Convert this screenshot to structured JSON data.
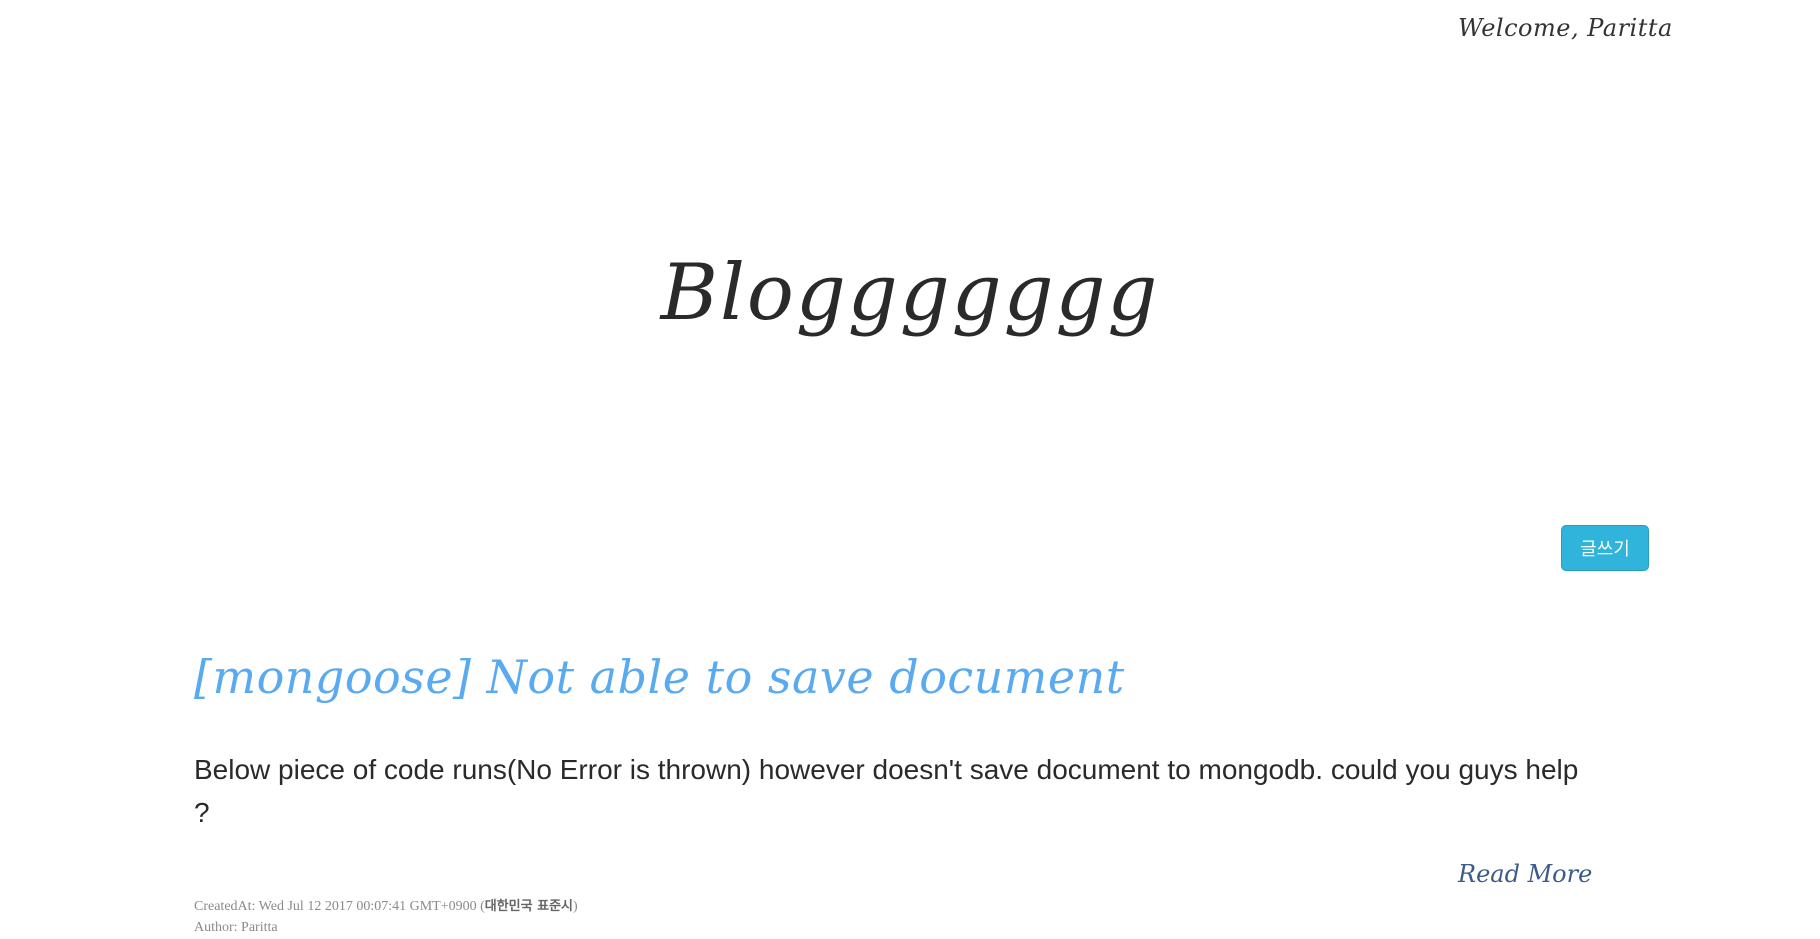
{
  "header": {
    "welcome_text": "Welcome, Paritta"
  },
  "blog": {
    "title": "Bloggggggg"
  },
  "toolbar": {
    "write_label": "글쓰기"
  },
  "post": {
    "title": "[mongoose] Not able to save document",
    "excerpt": "Below piece of code runs(No Error is thrown) however doesn't save document to mongodb. could you guys help ?",
    "read_more": "Read More",
    "created_prefix": "CreatedAt: Wed Jul 12 2017 00:07:41 GMT+0900 (",
    "created_tz": "대한민국 표준시",
    "created_suffix": ")",
    "author": "Author: Paritta"
  },
  "colors": {
    "accent_button": "#30b4db",
    "post_title": "#5aaaf0",
    "read_more": "#3c5a8a"
  }
}
